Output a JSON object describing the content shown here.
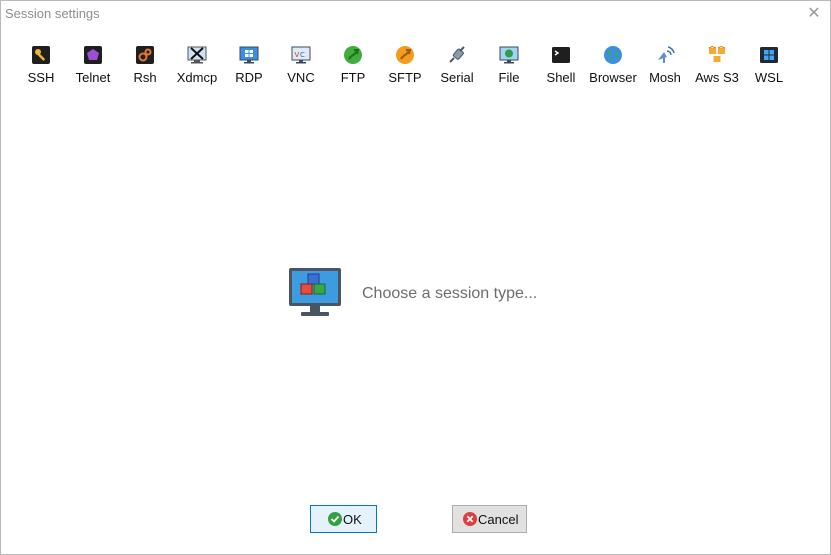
{
  "window": {
    "title": "Session settings"
  },
  "toolbar": {
    "items": [
      {
        "label": "SSH",
        "icon": "ssh-key-icon"
      },
      {
        "label": "Telnet",
        "icon": "telnet-icon"
      },
      {
        "label": "Rsh",
        "icon": "rsh-icon"
      },
      {
        "label": "Xdmcp",
        "icon": "xdmcp-icon"
      },
      {
        "label": "RDP",
        "icon": "rdp-icon"
      },
      {
        "label": "VNC",
        "icon": "vnc-icon"
      },
      {
        "label": "FTP",
        "icon": "ftp-icon"
      },
      {
        "label": "SFTP",
        "icon": "sftp-icon"
      },
      {
        "label": "Serial",
        "icon": "serial-icon"
      },
      {
        "label": "File",
        "icon": "file-icon"
      },
      {
        "label": "Shell",
        "icon": "shell-icon"
      },
      {
        "label": "Browser",
        "icon": "browser-icon"
      },
      {
        "label": "Mosh",
        "icon": "mosh-icon"
      },
      {
        "label": "Aws S3",
        "icon": "aws-s3-icon"
      },
      {
        "label": "WSL",
        "icon": "wsl-icon"
      }
    ]
  },
  "main": {
    "placeholder_text": "Choose a session type..."
  },
  "buttons": {
    "ok": "OK",
    "cancel": "Cancel"
  },
  "colors": {
    "ok_border": "#0078d7",
    "ok_background": "#e5f1fb",
    "button_background": "#e1e1e1",
    "window_border": "#b9b9b9"
  }
}
